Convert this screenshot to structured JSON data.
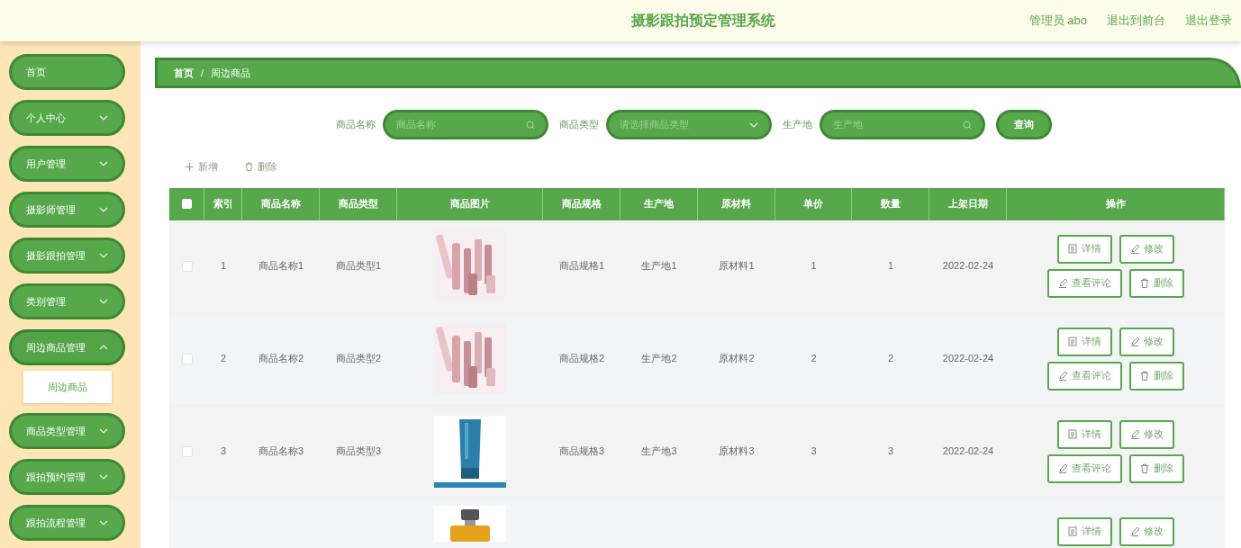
{
  "header": {
    "title": "摄影跟拍预定管理系统",
    "links": [
      "管理员 abo",
      "退出到前台",
      "退出登录"
    ]
  },
  "sidebar": {
    "items": [
      {
        "label": "首页"
      },
      {
        "label": "个人中心",
        "expanded": false
      },
      {
        "label": "用户管理",
        "expanded": false
      },
      {
        "label": "摄影师管理",
        "expanded": false
      },
      {
        "label": "摄影跟拍管理",
        "expanded": false
      },
      {
        "label": "类别管理",
        "expanded": false
      },
      {
        "label": "周边商品管理",
        "expanded": true,
        "children": [
          {
            "label": "周边商品",
            "selected": true
          }
        ]
      },
      {
        "label": "商品类型管理",
        "expanded": false
      },
      {
        "label": "跟拍预约管理",
        "expanded": false
      },
      {
        "label": "跟拍流程管理",
        "expanded": false
      }
    ]
  },
  "breadcrumb": [
    "首页",
    "/",
    "周边商品"
  ],
  "search": {
    "fields": [
      {
        "label": "商品名称",
        "placeholder": "商品名称",
        "kind": "search"
      },
      {
        "label": "商品类型",
        "placeholder": "请选择商品类型",
        "kind": "select"
      },
      {
        "label": "生产地",
        "placeholder": "生产地",
        "kind": "search"
      }
    ],
    "button": "查询"
  },
  "toolbar": [
    {
      "label": "新增",
      "kind": "add"
    },
    {
      "label": "删除",
      "kind": "delete"
    }
  ],
  "table": {
    "columns": [
      "索引",
      "商品名称",
      "商品类型",
      "商品图片",
      "商品规格",
      "生产地",
      "原材料",
      "单价",
      "数量",
      "上架日期",
      "操作"
    ],
    "all_checked": false,
    "rows": [
      {
        "checked": false,
        "cells": [
          "1",
          "商品名称1",
          "商品类型1",
          "",
          "商品规格1",
          "生产地1",
          "原材料1",
          "1",
          "1",
          "2022-02-24"
        ],
        "actions": [
          "详情",
          "修改",
          "查看评论",
          "删除"
        ]
      },
      {
        "checked": false,
        "cells": [
          "2",
          "商品名称2",
          "商品类型2",
          "",
          "商品规格2",
          "生产地2",
          "原材料2",
          "2",
          "2",
          "2022-02-24"
        ],
        "actions": [
          "详情",
          "修改",
          "查看评论",
          "删除"
        ]
      },
      {
        "checked": false,
        "cells": [
          "3",
          "商品名称3",
          "商品类型3",
          "",
          "商品规格3",
          "生产地3",
          "原材料3",
          "3",
          "3",
          "2022-02-24"
        ],
        "actions": [
          "详情",
          "修改",
          "查看评论",
          "删除"
        ]
      },
      {
        "actions": [
          "详情",
          "修改"
        ]
      }
    ]
  }
}
